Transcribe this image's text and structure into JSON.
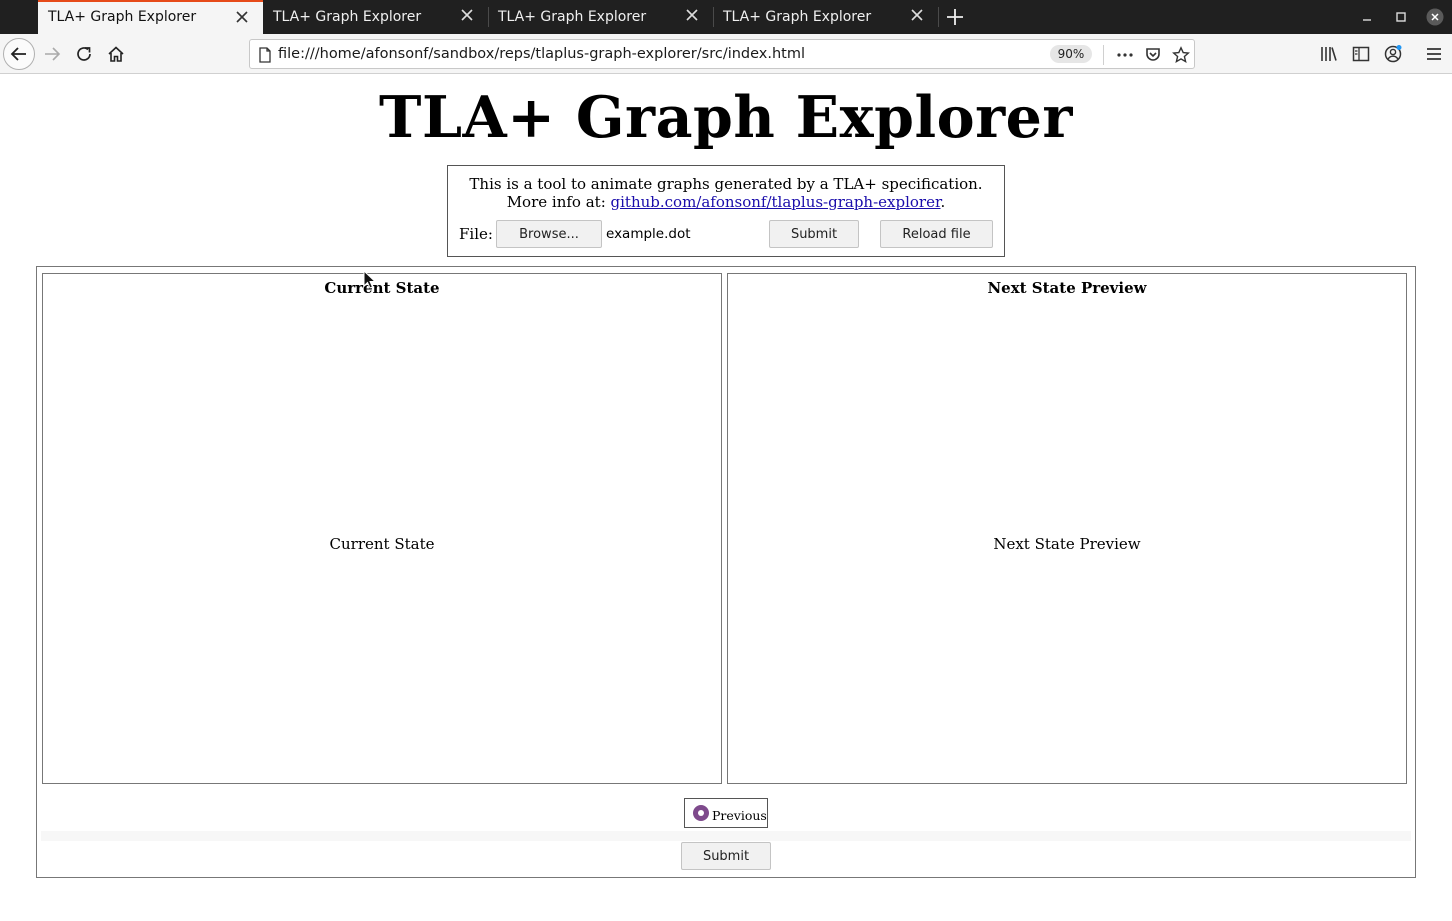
{
  "browser": {
    "tabs": [
      {
        "title": "TLA+ Graph Explorer",
        "active": true
      },
      {
        "title": "TLA+ Graph Explorer",
        "active": false
      },
      {
        "title": "TLA+ Graph Explorer",
        "active": false
      },
      {
        "title": "TLA+ Graph Explorer",
        "active": false
      }
    ],
    "url": "file:///home/afonsonf/sandbox/reps/tlaplus-graph-explorer/src/index.html",
    "zoom": "90%",
    "accent_color": "#e64a19"
  },
  "page": {
    "title": "TLA+ Graph Explorer",
    "intro_line1": "This is a tool to animate graphs generated by a TLA+ specification.",
    "intro_prefix": "More info at: ",
    "intro_link": "github.com/afonsonf/tlaplus-graph-explorer",
    "intro_suffix": ".",
    "file_label": "File:",
    "browse_label": "Browse...",
    "file_name": "example.dot",
    "submit_label": "Submit",
    "reload_label": "Reload file",
    "current_state_heading": "Current State",
    "current_state_body": "Current State",
    "next_state_heading": "Next State Preview",
    "next_state_body": "Next State Preview",
    "previous_option": "Previous",
    "bottom_submit_label": "Submit",
    "radio_color": "#7e4a8c"
  }
}
